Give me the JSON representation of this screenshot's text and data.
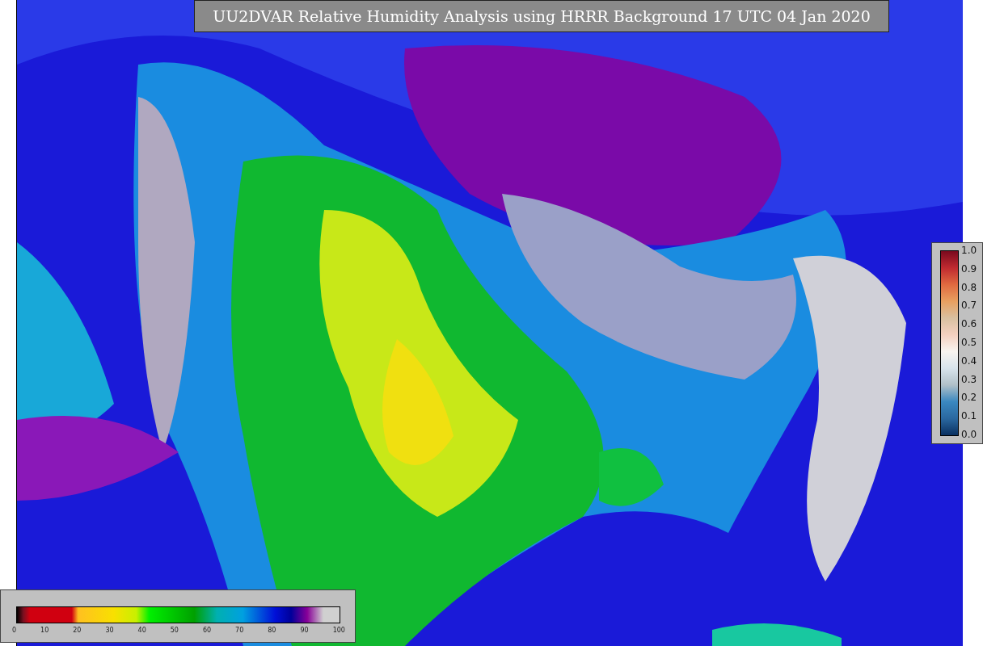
{
  "title": "UU2DVAR Relative Humidity Analysis using HRRR Background 17 UTC 04 Jan 2020",
  "humidity_legend": {
    "ticks": [
      "0",
      "10",
      "20",
      "30",
      "40",
      "50",
      "60",
      "70",
      "80",
      "90",
      "100"
    ]
  },
  "station_legend": {
    "ticks": [
      "1.0",
      "0.9",
      "0.8",
      "0.7",
      "0.6",
      "0.5",
      "0.4",
      "0.3",
      "0.2",
      "0.1",
      "0.0"
    ]
  }
}
